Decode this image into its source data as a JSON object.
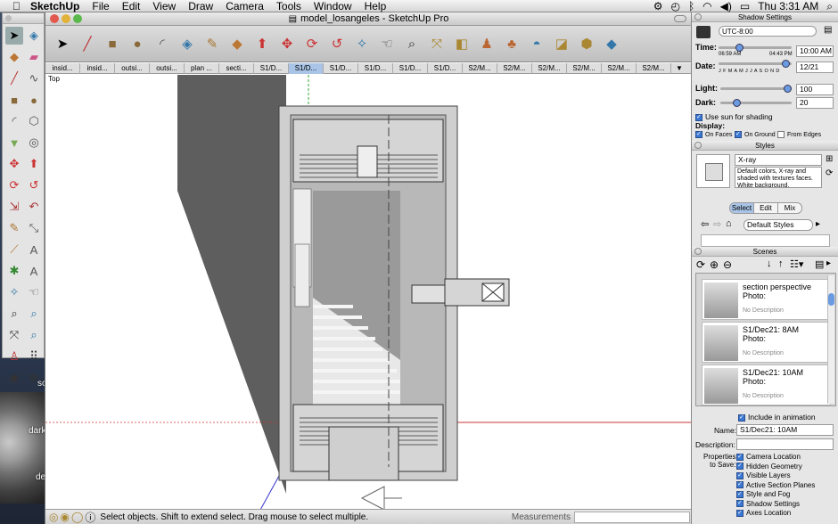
{
  "menubar": {
    "apple": "",
    "app_name": "SketchUp",
    "items": [
      "File",
      "Edit",
      "View",
      "Draw",
      "Camera",
      "Tools",
      "Window",
      "Help"
    ],
    "clock": "Thu 3:31 AM"
  },
  "desktop": {
    "labels": [
      "so",
      "dark",
      "de"
    ]
  },
  "window": {
    "title": "model_losangeles - SketchUp Pro",
    "view_label": "Top",
    "toolbar_icons": [
      "select-icon",
      "pencil-icon",
      "rectangle-icon",
      "circle-icon",
      "arc-icon",
      "eraser-icon",
      "tape-icon",
      "paint-bucket-icon",
      "push-pull-icon",
      "move-icon",
      "rotate-icon",
      "follow-me-icon",
      "orbit-icon",
      "pan-icon",
      "zoom-icon",
      "zoom-extents-icon",
      "previous-view-icon",
      "next-view-icon",
      "component-icon",
      "shadows-icon",
      "fog-icon",
      "warehouse-icon",
      "extension-icon",
      "share-icon"
    ],
    "scene_tabs": [
      "insid...",
      "insid...",
      "outsi...",
      "outsi...",
      "plan ...",
      "secti...",
      "S1/D...",
      "S1/D...",
      "S1/D...",
      "S1/D...",
      "S1/D...",
      "S1/D...",
      "S2/M...",
      "S2/M...",
      "S2/M...",
      "S2/M...",
      "S2/M...",
      "S2/M..."
    ],
    "selected_tab_index": 7,
    "status_text": "Select objects. Shift to extend select. Drag mouse to select multiple.",
    "measurements_label": "Measurements",
    "measurements_value": ""
  },
  "shadow": {
    "title": "Shadow Settings",
    "tz": "UTC-8:00",
    "time_label": "Time:",
    "time_start": "06:59 AM",
    "time_end": "04:43 PM",
    "time_value": "10:00 AM",
    "time_level": 0.26,
    "date_label": "Date:",
    "months": "J F M A M J J A S O N D",
    "date_value": "12/21",
    "date_level": 0.97,
    "light_label": "Light:",
    "light_value": "100",
    "light_level": 1.0,
    "dark_label": "Dark:",
    "dark_value": "20",
    "dark_level": 0.2,
    "use_sun": "Use sun for shading",
    "display_label": "Display:",
    "on_faces": "On Faces",
    "on_ground": "On Ground",
    "from_edges": "From Edges"
  },
  "styles": {
    "title": "Styles",
    "style_name": "X-ray",
    "style_desc": "Default colors, X-ray and shaded with textures",
    "style_desc_more": "faces. White background.",
    "tab_select": "Select",
    "tab_edit": "Edit",
    "tab_mix": "Mix",
    "collection": "Default Styles"
  },
  "scenes": {
    "title": "Scenes",
    "items": [
      {
        "name": "section perspective",
        "sub": "Photo:",
        "desc": "No Description"
      },
      {
        "name": "S1/Dec21: 8AM",
        "sub": "Photo:",
        "desc": "No Description"
      },
      {
        "name": "S1/Dec21: 10AM",
        "sub": "Photo:",
        "desc": "No Description"
      }
    ],
    "include_anim": "Include in animation",
    "name_label": "Name:",
    "name_value": "S1/Dec21: 10AM",
    "desc_label": "Description:",
    "desc_value": "",
    "props_label": "Properties",
    "props_label2": "to Save:",
    "props": [
      "Camera Location",
      "Hidden Geometry",
      "Visible Layers",
      "Active Section Planes",
      "Style and Fog",
      "Shadow Settings",
      "Axes Location"
    ]
  },
  "colors": {
    "accent": "#3a78d4",
    "tab_selected": "#a9c4e6",
    "axis_red": "#cc3333",
    "axis_green": "#33aa33"
  }
}
